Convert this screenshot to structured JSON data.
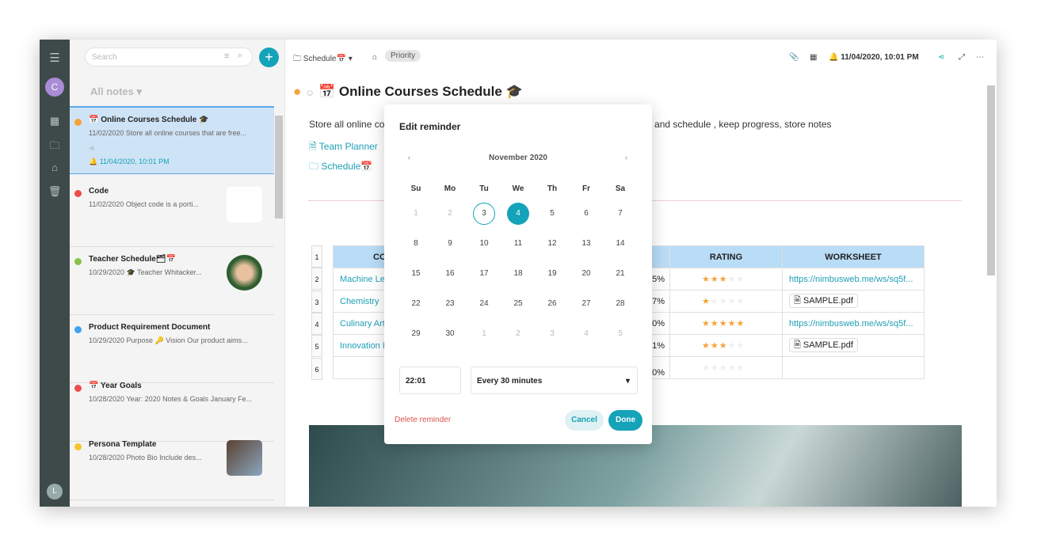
{
  "rail": {
    "avatar_top": "C",
    "avatar_bottom": "L",
    "avatar_color": "#a98bd6"
  },
  "list": {
    "search_placeholder": "Search",
    "all_notes": "All notes",
    "notes": [
      {
        "title": "📅 Online Courses Schedule 🎓",
        "snippet": "11/02/2020 Store all online courses that are free...",
        "reminder": "11/04/2020, 10:01 PM",
        "color": "#f7a23a"
      },
      {
        "title": "Code",
        "snippet": "11/02/2020 Object code is a porti...",
        "color": "#ec4c4c"
      },
      {
        "title": "Teacher Schedule🗂📅",
        "snippet": "10/29/2020 🎓 Teacher Whitacker...",
        "color": "#8bc34a"
      },
      {
        "title": "Product Requirement Document",
        "snippet": "10/29/2020 Purpose 🔑 Vision Our product aims...",
        "color": "#3fa2f0"
      },
      {
        "title": "📅 Year Goals",
        "snippet": "10/28/2020 Year: 2020 Notes & Goals January Fe...",
        "color": "#ec4c4c"
      },
      {
        "title": "Persona Template",
        "snippet": "10/28/2020 Photo Bio Include des...",
        "color": "#f7c52a"
      }
    ]
  },
  "toolbar": {
    "folder": "Schedule📅",
    "tag": "Priority",
    "reminder": "11/04/2020, 10:01 PM"
  },
  "note": {
    "title": "📅 Online Courses Schedule 🎓",
    "para_start": "Store all online co",
    "para_end": "' and schedule , keep progress, store notes",
    "link1": "Team Planner",
    "link2": "Schedule📅",
    "table": {
      "row_numbers": [
        "1",
        "2",
        "3",
        "4",
        "5",
        "6"
      ],
      "headers": [
        "CO",
        "RATING",
        "WORKSHEET"
      ],
      "rows": [
        {
          "course": "Machine Le",
          "pct": "5%",
          "rating": 3,
          "worksheet": "https://nimbusweb.me/ws/sq5f..."
        },
        {
          "course": "Chemistry",
          "pct": "7%",
          "rating": 1,
          "file": "SAMPLE.pdf"
        },
        {
          "course": "Culinary Art",
          "pct": "0%",
          "rating": 5,
          "worksheet": "https://nimbusweb.me/ws/sq5f..."
        },
        {
          "course": "Innovation I",
          "pct": "1%",
          "rating": 3,
          "file": "SAMPLE.pdf"
        },
        {
          "course": "",
          "pct": "0%",
          "rating": 0
        }
      ]
    }
  },
  "reminder": {
    "title": "Edit reminder",
    "month": "November 2020",
    "weekdays": [
      "Su",
      "Mo",
      "Tu",
      "We",
      "Th",
      "Fr",
      "Sa"
    ],
    "days": [
      "1",
      "2",
      "3",
      "4",
      "5",
      "6",
      "7",
      "8",
      "9",
      "10",
      "11",
      "12",
      "13",
      "14",
      "15",
      "16",
      "17",
      "18",
      "19",
      "20",
      "21",
      "22",
      "23",
      "24",
      "25",
      "26",
      "27",
      "28",
      "29",
      "30",
      "1",
      "2",
      "3",
      "4",
      "5"
    ],
    "today": "3",
    "selected": "4",
    "time": "22:01",
    "repeat": "Every 30 minutes",
    "delete": "Delete reminder",
    "cancel": "Cancel",
    "done": "Done",
    "accent": "#14a3b8"
  }
}
